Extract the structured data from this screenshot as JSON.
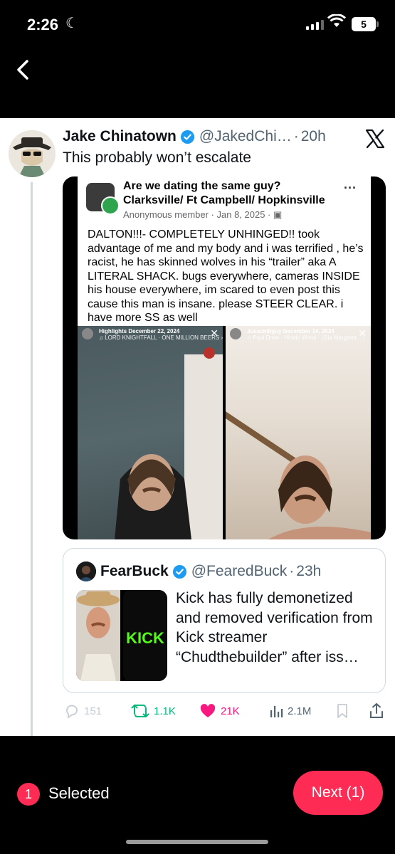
{
  "status_bar": {
    "time": "2:26",
    "battery": "5"
  },
  "tweet": {
    "author_name": "Jake Chinatown",
    "handle": "@JakedChi…",
    "separator": "·",
    "time": "20h",
    "text": "This probably won’t escalate"
  },
  "embedded_post": {
    "group_title": "Are we dating the same guy? Clarksville/ Ft Campbell/ Hopkinsville",
    "meta": "Anonymous member · Jan 8, 2025 · ",
    "body": "DALTON!!!- COMPLETELY UNHINGED!! took advantage of me and my body and i was terrified , he’s racist, he has skinned wolves in his “trailer” aka A LITERAL SHACK. bugs everywhere, cameras INSIDE his house everywhere, im scared to even post this cause this man is insane. please STEER CLEAR. i have more SS as well",
    "left_story": {
      "user": "Highlights December 22, 2024",
      "song": "♫ LORD KNIGHTFALL · ONE MILLION BEERS ›"
    },
    "right_story": {
      "user": "Jusachillguy December 14, 2024",
      "song": "♫ Paul Drew · Hinoki Wood · (Gia Margaret... ›"
    }
  },
  "quote": {
    "author_name": "FearBuck",
    "handle": "@FearedBuck",
    "separator": "·",
    "time": "23h",
    "text": "Kick has fully demonetized and removed verification from Kick streamer “Chudthebuilder” after iss…",
    "thumb_text": "KICK"
  },
  "actions": {
    "replies": "151",
    "reposts": "1.1K",
    "likes": "21K",
    "views": "2.1M"
  },
  "footer": {
    "selected_count": "1",
    "selected_label": "Selected",
    "next_label": "Next (1)"
  },
  "colors": {
    "accent": "#fe2c55",
    "verified": "#1d9bf0",
    "repost": "#00ba7c",
    "like": "#f91880"
  }
}
